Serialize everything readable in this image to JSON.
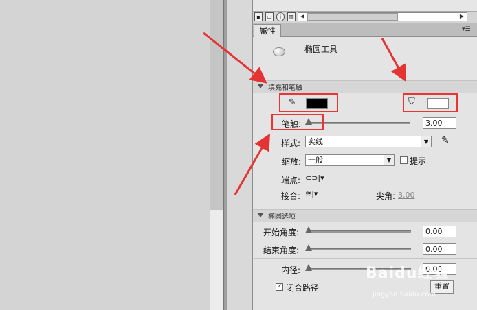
{
  "panel": {
    "tab_label": "属性",
    "menu_glyph": "▾☰",
    "tool_name": "椭圆工具"
  },
  "fill_stroke": {
    "section_title": "填充和笔触",
    "stroke_color": "#000000",
    "fill_color": "#ffffff",
    "stroke_label": "笔触:",
    "stroke_value": "3.00",
    "style_label": "样式:",
    "style_value": "实线",
    "scale_label": "缩放:",
    "scale_value": "一般",
    "hint_label": "提示",
    "cap_label": "端点:",
    "join_label": "接合:",
    "miter_label": "尖角:",
    "miter_value": "3.00"
  },
  "ellipse_options": {
    "section_title": "椭圆选项",
    "start_angle_label": "开始角度:",
    "start_angle_value": "0.00",
    "end_angle_label": "结束角度:",
    "end_angle_value": "0.00",
    "inner_radius_label": "内径:",
    "inner_radius_value": "0.00",
    "close_path_label": "闭合路径",
    "close_path_checked": true,
    "reset_label": "重置"
  },
  "watermark": {
    "brand": "Baidu经验",
    "url": "jingyan.baidu.com"
  },
  "icons": [
    "stroke-pencil-icon",
    "fill-bucket-icon",
    "ellipse-tool-icon",
    "edit-pencil-icon",
    "panel-menu-icon"
  ],
  "accent_colors": {
    "annotation_red": "#e33333"
  }
}
